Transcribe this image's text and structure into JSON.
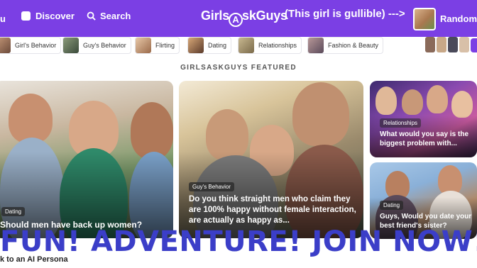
{
  "topbar": {
    "nav_fragment": "u",
    "discover_label": "Discover",
    "search_label": "Search",
    "logo_text_pre": "Girls",
    "logo_text_ring": "A",
    "logo_text_post": "skGuys",
    "annotation": "(This girl is gullible) --->",
    "username": "RandomG",
    "icons": [
      "discover-icon",
      "search-icon",
      "avatar"
    ]
  },
  "categories": [
    {
      "label": "Girl's Behavior"
    },
    {
      "label": "Guy's Behavior"
    },
    {
      "label": "Flirting"
    },
    {
      "label": "Dating"
    },
    {
      "label": "Relationships"
    },
    {
      "label": "Fashion & Beauty"
    }
  ],
  "featured": {
    "section_label": "GIRLSASKGUYS FEATURED",
    "cards": [
      {
        "tag": "Dating",
        "title": "Should men have back up women?"
      },
      {
        "tag": "Guy's Behavior",
        "title": "Do you think straight men who claim they are 100% happy without female interaction, are actually as happy as..."
      },
      {
        "tag": "Relationships",
        "title": "What would you say is the biggest problem with..."
      },
      {
        "tag": "Dating",
        "title": "Guys, Would you date your best friend's sister?"
      }
    ]
  },
  "banner": {
    "text": "FUN! ADVENTURE! JOIN NOW!"
  },
  "footer": {
    "back_link": "k to an AI Persona"
  },
  "colors": {
    "brand": "#7b3fe4",
    "banner_text": "#3b3ec8"
  }
}
